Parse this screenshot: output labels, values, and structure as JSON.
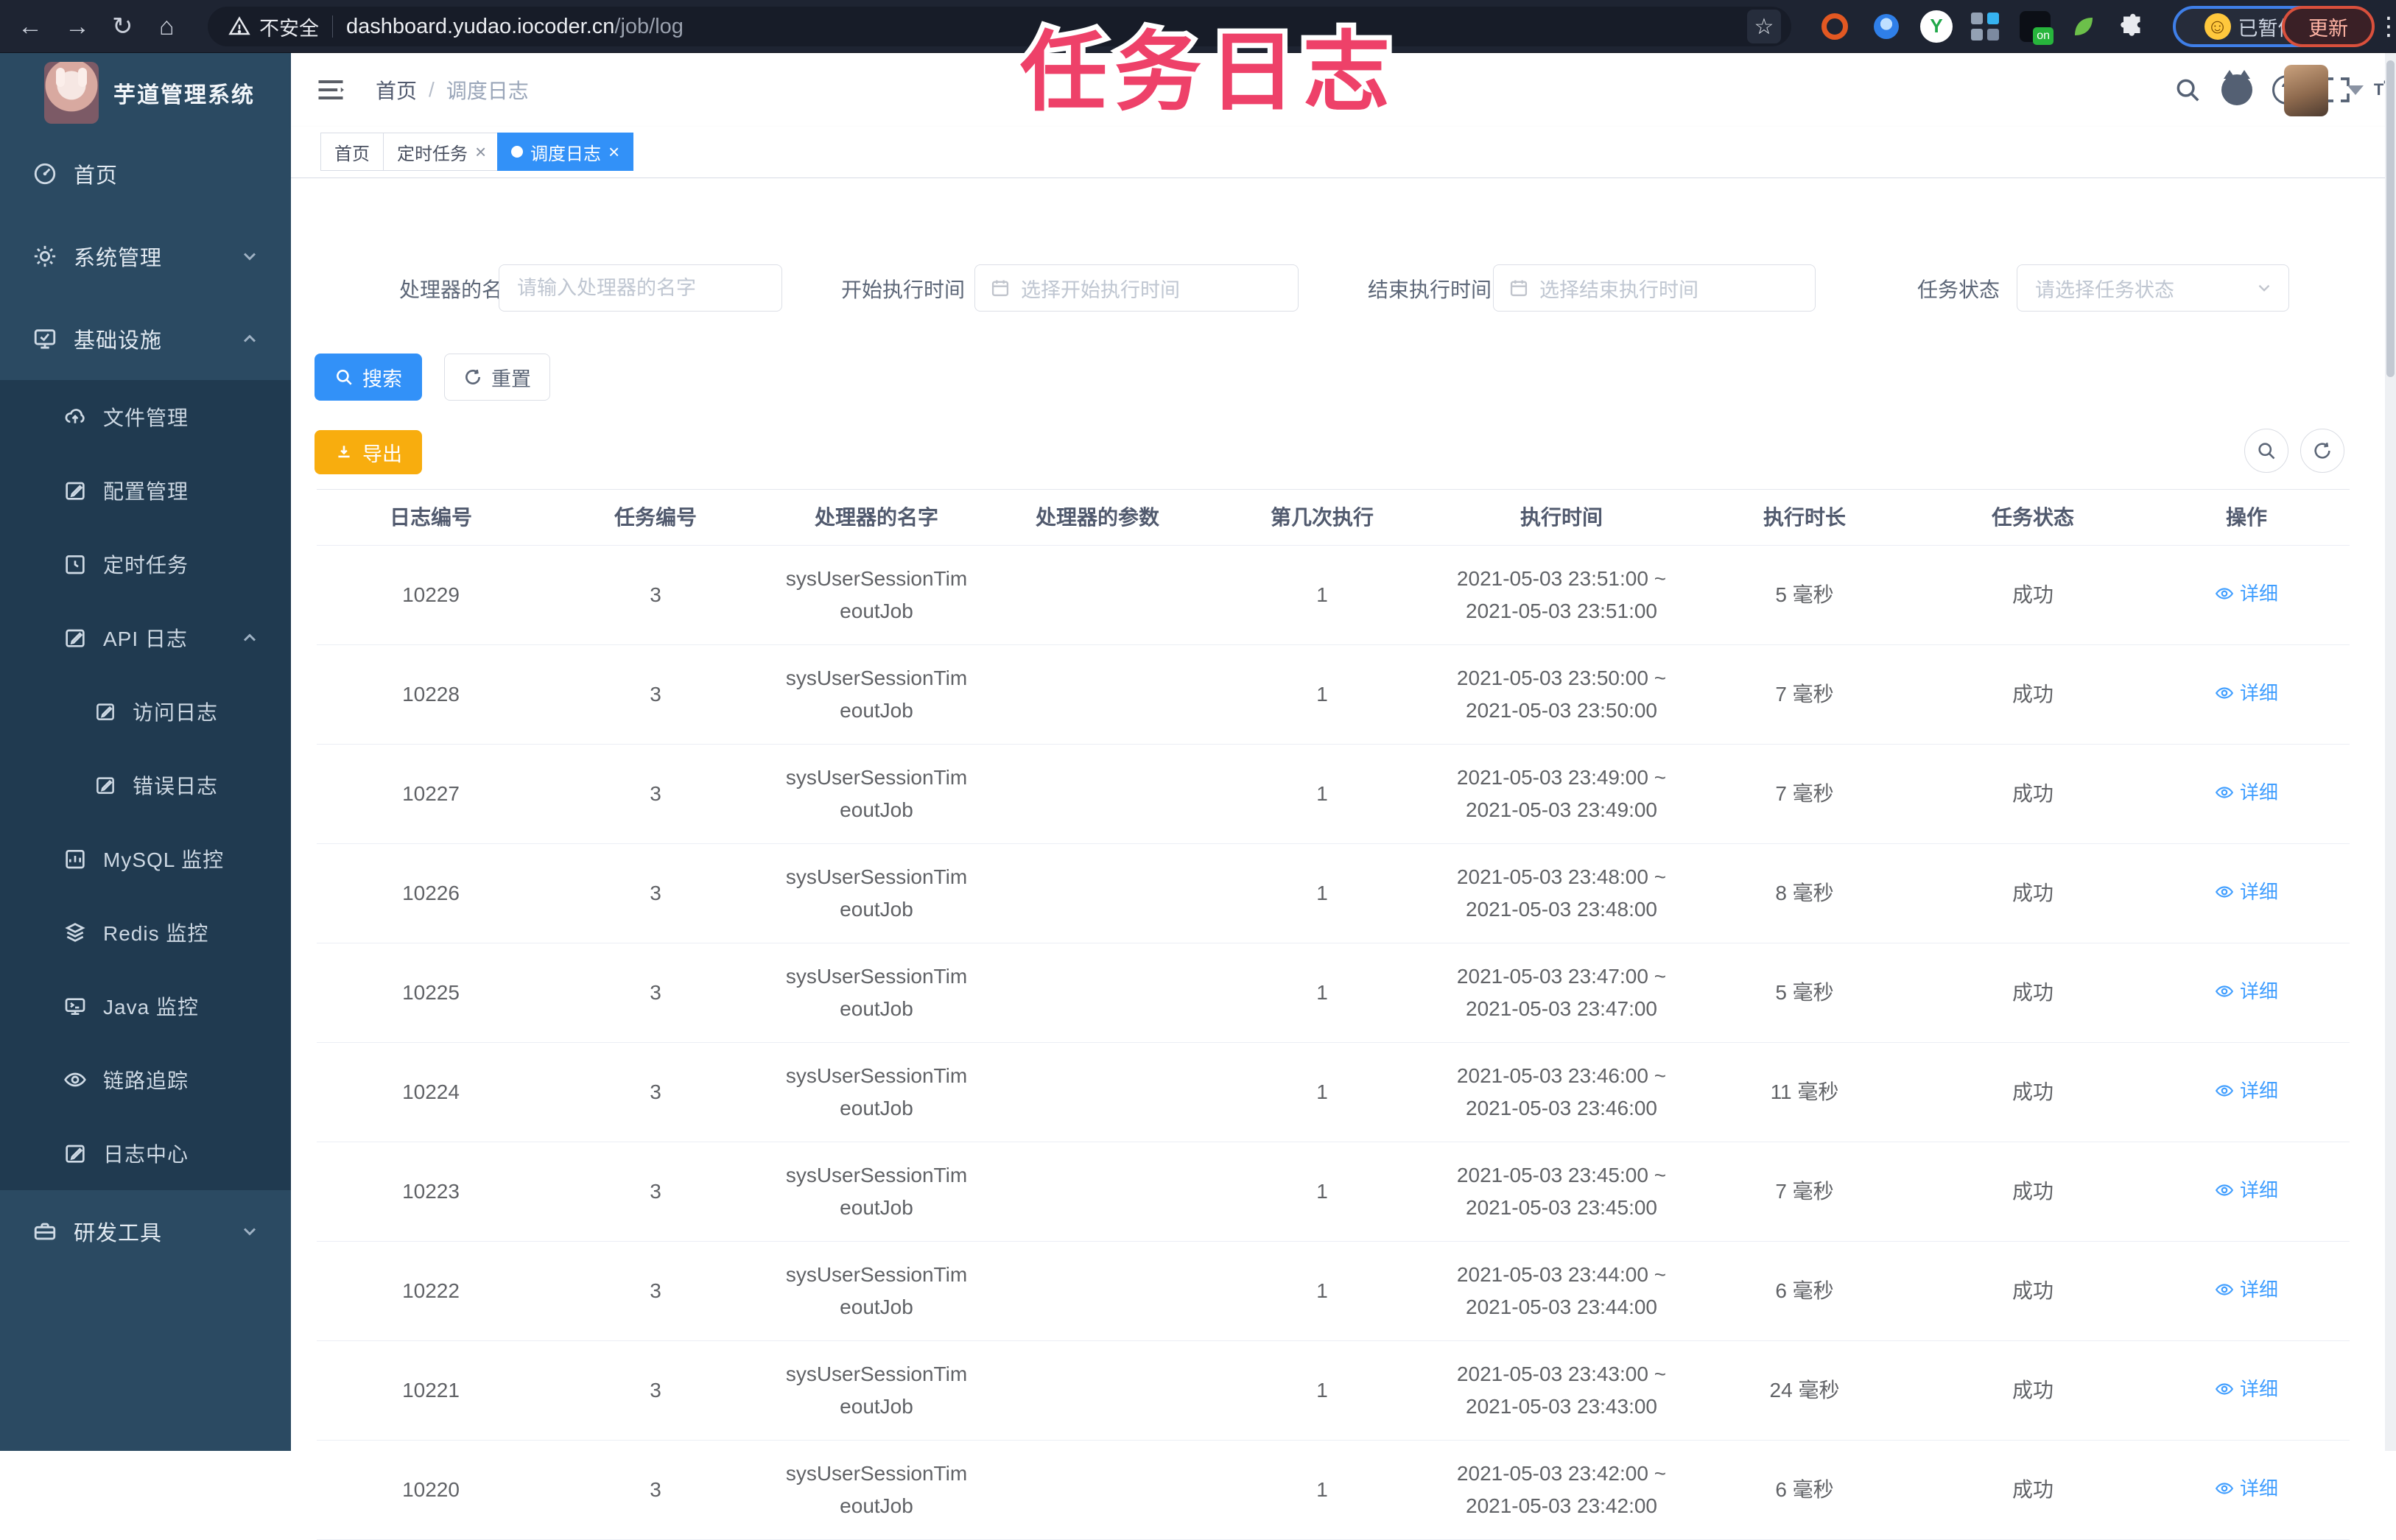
{
  "browser": {
    "security_label": "不安全",
    "url_main": "dashboard.yudao.iocoder.cn",
    "url_path": "/job/log",
    "paused_badge": "已暂停",
    "update_button": "更新"
  },
  "watermark": "任务日志",
  "app": {
    "title": "芋道管理系统"
  },
  "breadcrumb": {
    "home": "首页",
    "separator": "/",
    "current": "调度日志"
  },
  "tabs": [
    {
      "label": "首页",
      "active": false,
      "closable": false
    },
    {
      "label": "定时任务",
      "active": false,
      "closable": true
    },
    {
      "label": "调度日志",
      "active": true,
      "closable": true
    }
  ],
  "close_glyph": "×",
  "sidebar": {
    "items": [
      {
        "label": "首页",
        "icon": "dashboard-icon",
        "level": 1
      },
      {
        "label": "系统管理",
        "icon": "gear-icon",
        "level": 1,
        "chevron": "down"
      },
      {
        "label": "基础设施",
        "icon": "infrastructure-icon",
        "level": 1,
        "chevron": "up"
      },
      {
        "label": "文件管理",
        "icon": "cloud-upload-icon",
        "level": 2
      },
      {
        "label": "配置管理",
        "icon": "edit-icon",
        "level": 2
      },
      {
        "label": "定时任务",
        "icon": "schedule-icon",
        "level": 2
      },
      {
        "label": "API 日志",
        "icon": "log-icon",
        "level": 2,
        "chevron": "up"
      },
      {
        "label": "访问日志",
        "icon": "log-icon",
        "level": 3
      },
      {
        "label": "错误日志",
        "icon": "log-icon",
        "level": 3
      },
      {
        "label": "MySQL 监控",
        "icon": "mysql-icon",
        "level": 2
      },
      {
        "label": "Redis 监控",
        "icon": "redis-icon",
        "level": 2
      },
      {
        "label": "Java 监控",
        "icon": "java-monitor-icon",
        "level": 2
      },
      {
        "label": "链路追踪",
        "icon": "eye-icon",
        "level": 2
      },
      {
        "label": "日志中心",
        "icon": "log-icon",
        "level": 2
      },
      {
        "label": "研发工具",
        "icon": "toolbox-icon",
        "level": 1,
        "chevron": "down"
      }
    ]
  },
  "filters": {
    "handler_name": {
      "label": "处理器的名字",
      "placeholder": "请输入处理器的名字"
    },
    "start_time": {
      "label": "开始执行时间",
      "placeholder": "选择开始执行时间"
    },
    "end_time": {
      "label": "结束执行时间",
      "placeholder": "选择结束执行时间"
    },
    "status": {
      "label": "任务状态",
      "placeholder": "请选择任务状态"
    }
  },
  "actions": {
    "search": "搜索",
    "reset": "重置",
    "export": "导出"
  },
  "table": {
    "headers": [
      "日志编号",
      "任务编号",
      "处理器的名字",
      "处理器的参数",
      "第几次执行",
      "执行时间",
      "执行时长",
      "任务状态",
      "操作"
    ],
    "detail_label": "详细",
    "rows": [
      {
        "log_id": "10229",
        "job_id": "3",
        "handler_line1": "sysUserSessionTim",
        "handler_line2": "eoutJob",
        "param": "",
        "execute_index": "1",
        "time_start": "2021-05-03 23:51:00 ~",
        "time_end": "2021-05-03 23:51:00",
        "duration": "5 毫秒",
        "status": "成功"
      },
      {
        "log_id": "10228",
        "job_id": "3",
        "handler_line1": "sysUserSessionTim",
        "handler_line2": "eoutJob",
        "param": "",
        "execute_index": "1",
        "time_start": "2021-05-03 23:50:00 ~",
        "time_end": "2021-05-03 23:50:00",
        "duration": "7 毫秒",
        "status": "成功"
      },
      {
        "log_id": "10227",
        "job_id": "3",
        "handler_line1": "sysUserSessionTim",
        "handler_line2": "eoutJob",
        "param": "",
        "execute_index": "1",
        "time_start": "2021-05-03 23:49:00 ~",
        "time_end": "2021-05-03 23:49:00",
        "duration": "7 毫秒",
        "status": "成功"
      },
      {
        "log_id": "10226",
        "job_id": "3",
        "handler_line1": "sysUserSessionTim",
        "handler_line2": "eoutJob",
        "param": "",
        "execute_index": "1",
        "time_start": "2021-05-03 23:48:00 ~",
        "time_end": "2021-05-03 23:48:00",
        "duration": "8 毫秒",
        "status": "成功"
      },
      {
        "log_id": "10225",
        "job_id": "3",
        "handler_line1": "sysUserSessionTim",
        "handler_line2": "eoutJob",
        "param": "",
        "execute_index": "1",
        "time_start": "2021-05-03 23:47:00 ~",
        "time_end": "2021-05-03 23:47:00",
        "duration": "5 毫秒",
        "status": "成功"
      },
      {
        "log_id": "10224",
        "job_id": "3",
        "handler_line1": "sysUserSessionTim",
        "handler_line2": "eoutJob",
        "param": "",
        "execute_index": "1",
        "time_start": "2021-05-03 23:46:00 ~",
        "time_end": "2021-05-03 23:46:00",
        "duration": "11 毫秒",
        "status": "成功"
      },
      {
        "log_id": "10223",
        "job_id": "3",
        "handler_line1": "sysUserSessionTim",
        "handler_line2": "eoutJob",
        "param": "",
        "execute_index": "1",
        "time_start": "2021-05-03 23:45:00 ~",
        "time_end": "2021-05-03 23:45:00",
        "duration": "7 毫秒",
        "status": "成功"
      },
      {
        "log_id": "10222",
        "job_id": "3",
        "handler_line1": "sysUserSessionTim",
        "handler_line2": "eoutJob",
        "param": "",
        "execute_index": "1",
        "time_start": "2021-05-03 23:44:00 ~",
        "time_end": "2021-05-03 23:44:00",
        "duration": "6 毫秒",
        "status": "成功"
      },
      {
        "log_id": "10221",
        "job_id": "3",
        "handler_line1": "sysUserSessionTim",
        "handler_line2": "eoutJob",
        "param": "",
        "execute_index": "1",
        "time_start": "2021-05-03 23:43:00 ~",
        "time_end": "2021-05-03 23:43:00",
        "duration": "24 毫秒",
        "status": "成功"
      },
      {
        "log_id": "10220",
        "job_id": "3",
        "handler_line1": "sysUserSessionTim",
        "handler_line2": "eoutJob",
        "param": "",
        "execute_index": "1",
        "time_start": "2021-05-03 23:42:00 ~",
        "time_end": "2021-05-03 23:42:00",
        "duration": "6 毫秒",
        "status": "成功"
      }
    ]
  },
  "colors": {
    "primary": "#3291f8",
    "warning": "#f8ad0e",
    "watermark": "#ee4169",
    "sidebar_bg": "#2b4a62",
    "submenu_bg": "#203a50",
    "active_tag": "#3291f8",
    "link": "#409eff"
  }
}
